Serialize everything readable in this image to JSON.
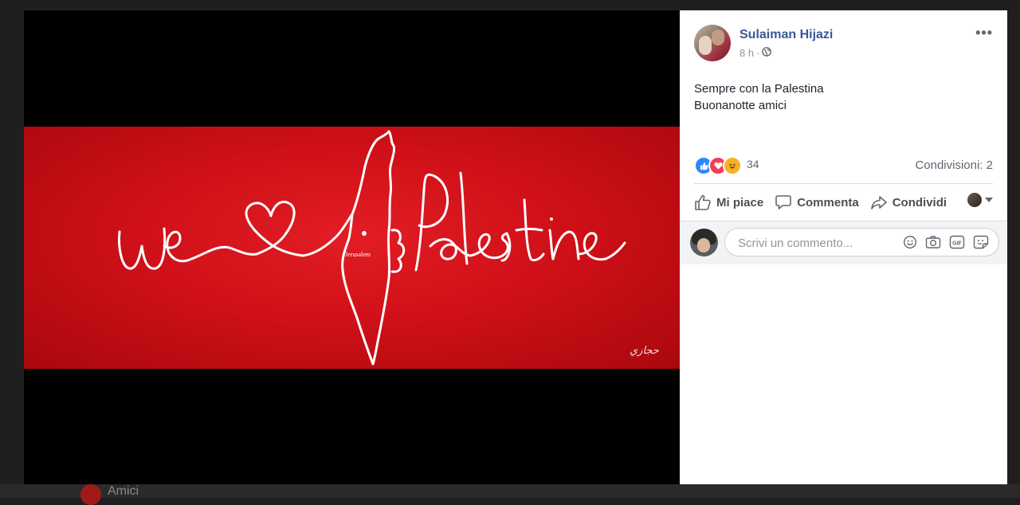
{
  "background": {
    "label": "Amici"
  },
  "photo": {
    "script_text": "We Palestine",
    "map_label": "Jerusalem",
    "signature": "ﺣﺠﺎﺯﻱ",
    "colors": {
      "red": "#d01018",
      "line": "#ffffff"
    }
  },
  "post": {
    "author": "Sulaiman Hijazi",
    "time": "8 h",
    "separator": "·",
    "privacy_icon": "globe-icon",
    "more": "•••",
    "text_lines": [
      "Sempre con la Palestina",
      "Buonanotte amici"
    ],
    "reactions": {
      "icons": [
        "like",
        "love",
        "haha"
      ],
      "count": "34"
    },
    "shares": "Condivisioni: 2",
    "actions": {
      "like": "Mi piace",
      "comment": "Commenta",
      "share": "Condividi"
    },
    "comment": {
      "placeholder": "Scrivi un commento...",
      "tools": [
        "smiley-icon",
        "camera-icon",
        "gif-icon",
        "sticker-icon"
      ]
    }
  },
  "colors": {
    "link": "#385898",
    "like_blue": "#2d88ff",
    "love_red": "#f33e58",
    "haha_yellow": "#f7b125"
  }
}
